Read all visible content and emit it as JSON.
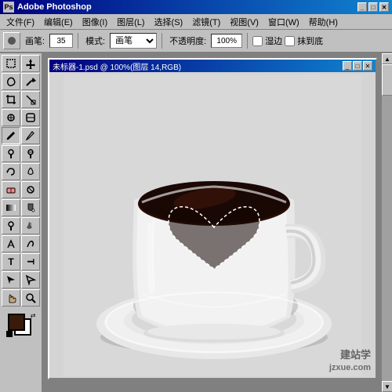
{
  "app": {
    "title": "Adobe Photoshop",
    "title_icon": "PS"
  },
  "menu": {
    "items": [
      {
        "label": "文件(F)"
      },
      {
        "label": "编辑(E)"
      },
      {
        "label": "图像(I)"
      },
      {
        "label": "图层(L)"
      },
      {
        "label": "选择(S)"
      },
      {
        "label": "滤镜(T)"
      },
      {
        "label": "视图(V)"
      },
      {
        "label": "窗口(W)"
      },
      {
        "label": "帮助(H)"
      }
    ]
  },
  "toolbar": {
    "brush_label": "画笔:",
    "brush_size": "35",
    "mode_label": "模式:",
    "mode_value": "画笔",
    "opacity_label": "不透明度:",
    "opacity_value": "100%",
    "wet_label": "湿边",
    "airbrush_label": "抹到底"
  },
  "canvas": {
    "title": "未标器-1.psd @ 100%(图层 14,RGB)"
  },
  "tools": [
    {
      "icon": "▣",
      "name": "marquee-tool",
      "title": "矩形选框"
    },
    {
      "icon": "⋯",
      "name": "lasso-tool",
      "title": "套索"
    },
    {
      "icon": "✂",
      "name": "crop-tool",
      "title": "裁剪"
    },
    {
      "icon": "⊘",
      "name": "healing-tool",
      "title": "修复"
    },
    {
      "icon": "✏",
      "name": "brush-tool",
      "title": "画笔"
    },
    {
      "icon": "S",
      "name": "stamp-tool",
      "title": "仿制图章"
    },
    {
      "icon": "↩",
      "name": "history-tool",
      "title": "历史记录"
    },
    {
      "icon": "◈",
      "name": "eraser-tool",
      "title": "橡皮擦"
    },
    {
      "icon": "▦",
      "name": "gradient-tool",
      "title": "渐变"
    },
    {
      "icon": "◎",
      "name": "dodge-tool",
      "title": "减淡"
    },
    {
      "icon": "⌖",
      "name": "pen-tool",
      "title": "钢笔"
    },
    {
      "icon": "T",
      "name": "type-tool",
      "title": "文字"
    },
    {
      "icon": "✳",
      "name": "shape-tool",
      "title": "形状"
    },
    {
      "icon": "▷",
      "name": "move-tool",
      "title": "移动"
    },
    {
      "icon": "☞",
      "name": "hand-tool",
      "title": "抓手"
    },
    {
      "icon": "🔍",
      "name": "zoom-tool",
      "title": "缩放"
    }
  ],
  "colors": {
    "fg": "#3a1a0a",
    "bg": "#ffffff",
    "accent": "#000080",
    "ui_bg": "#c0c0c0",
    "canvas_bg": "#d4d4d4",
    "workspace": "#808080"
  },
  "watermark": {
    "line1": "建站学",
    "line2": "jzxue.com"
  }
}
